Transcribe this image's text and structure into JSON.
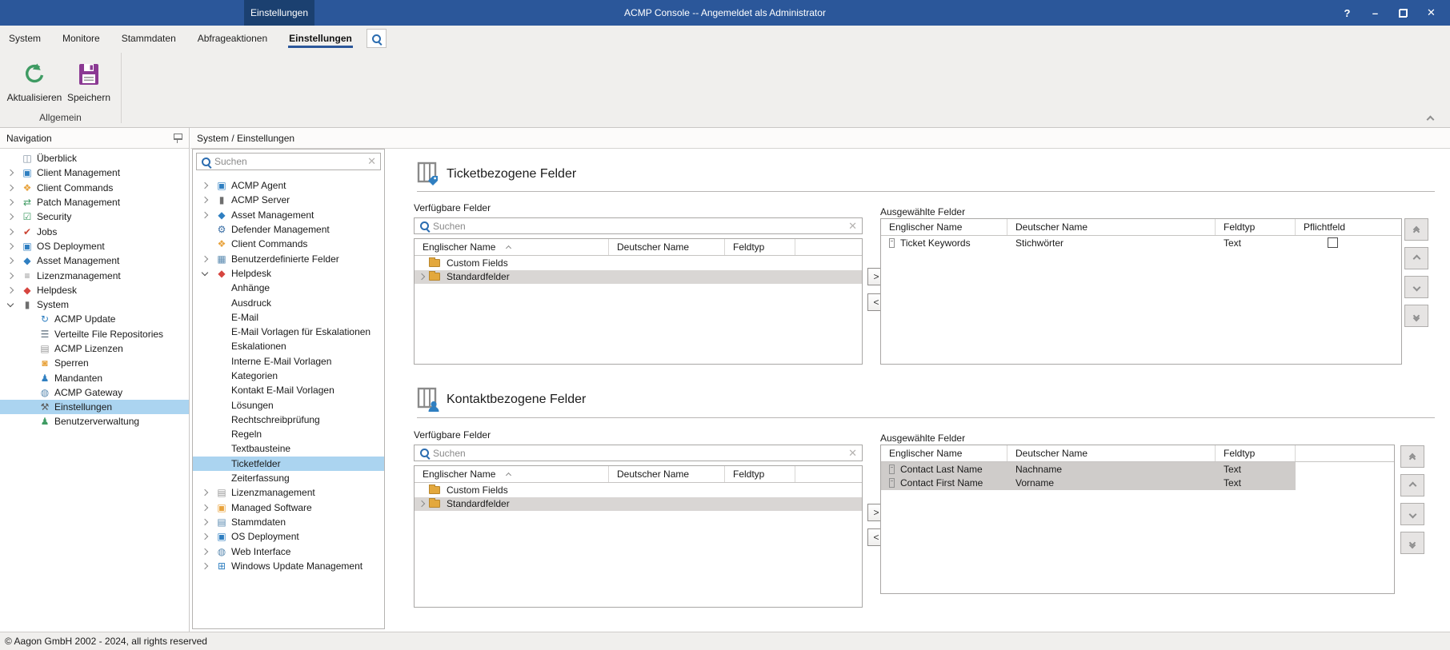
{
  "window": {
    "title": "ACMP Console -- Angemeldet als Administrator",
    "titlebar_tab": "Einstellungen",
    "controls": {
      "help": "?",
      "minimize": "–",
      "close": "✕"
    }
  },
  "menubar": {
    "items": [
      "System",
      "Monitore",
      "Stammdaten",
      "Abfrageaktionen",
      "Einstellungen"
    ],
    "active": "Einstellungen"
  },
  "ribbon": {
    "buttons": [
      {
        "label": "Aktualisieren",
        "icon": "refresh-icon"
      },
      {
        "label": "Speichern",
        "icon": "save-icon"
      }
    ],
    "group_label": "Allgemein"
  },
  "navigation": {
    "title": "Navigation",
    "items": [
      {
        "label": "Überblick",
        "icon": "overview",
        "exp": "none"
      },
      {
        "label": "Client Management",
        "icon": "client-management",
        "exp": "closed"
      },
      {
        "label": "Client Commands",
        "icon": "client-commands",
        "exp": "closed"
      },
      {
        "label": "Patch Management",
        "icon": "patch-management",
        "exp": "closed"
      },
      {
        "label": "Security",
        "icon": "security",
        "exp": "closed"
      },
      {
        "label": "Jobs",
        "icon": "jobs",
        "exp": "closed"
      },
      {
        "label": "OS Deployment",
        "icon": "os-deployment",
        "exp": "closed"
      },
      {
        "label": "Asset Management",
        "icon": "asset-management",
        "exp": "closed"
      },
      {
        "label": "Lizenzmanagement",
        "icon": "lizenzmanagement",
        "exp": "closed"
      },
      {
        "label": "Helpdesk",
        "icon": "helpdesk",
        "exp": "closed"
      },
      {
        "label": "System",
        "icon": "system",
        "exp": "open"
      },
      {
        "label": "ACMP Update",
        "icon": "acmp-update",
        "exp": "none",
        "child": true
      },
      {
        "label": "Verteilte File Repositories",
        "icon": "file-repositories",
        "exp": "none",
        "child": true
      },
      {
        "label": "ACMP Lizenzen",
        "icon": "acmp-lizenzen",
        "exp": "none",
        "child": true
      },
      {
        "label": "Sperren",
        "icon": "sperren",
        "exp": "none",
        "child": true
      },
      {
        "label": "Mandanten",
        "icon": "mandanten",
        "exp": "none",
        "child": true
      },
      {
        "label": "ACMP Gateway",
        "icon": "acmp-gateway",
        "exp": "none",
        "child": true
      },
      {
        "label": "Einstellungen",
        "icon": "einstellungen",
        "exp": "none",
        "child": true,
        "selected": true
      },
      {
        "label": "Benutzerverwaltung",
        "icon": "benutzerverwaltung",
        "exp": "none",
        "child": true
      }
    ]
  },
  "path_header": "System / Einstellungen",
  "settings_tree": {
    "search_placeholder": "Suchen",
    "items": [
      {
        "label": "ACMP Agent",
        "icon": "acmp-agent",
        "exp": "closed"
      },
      {
        "label": "ACMP Server",
        "icon": "acmp-server",
        "exp": "closed"
      },
      {
        "label": "Asset Management",
        "icon": "asset-management",
        "exp": "closed"
      },
      {
        "label": "Defender Management",
        "icon": "defender-management",
        "exp": "none"
      },
      {
        "label": "Client Commands",
        "icon": "client-commands",
        "exp": "none"
      },
      {
        "label": "Benutzerdefinierte Felder",
        "icon": "benutzerdefinierte-felder",
        "exp": "closed"
      },
      {
        "label": "Helpdesk",
        "icon": "helpdesk",
        "exp": "open"
      },
      {
        "label": "Anhänge",
        "child": true
      },
      {
        "label": "Ausdruck",
        "child": true
      },
      {
        "label": "E-Mail",
        "child": true
      },
      {
        "label": "E-Mail Vorlagen für Eskalationen",
        "child": true
      },
      {
        "label": "Eskalationen",
        "child": true
      },
      {
        "label": "Interne E-Mail Vorlagen",
        "child": true
      },
      {
        "label": "Kategorien",
        "child": true
      },
      {
        "label": "Kontakt E-Mail Vorlagen",
        "child": true
      },
      {
        "label": "Lösungen",
        "child": true
      },
      {
        "label": "Rechtschreibprüfung",
        "child": true
      },
      {
        "label": "Regeln",
        "child": true
      },
      {
        "label": "Textbausteine",
        "child": true
      },
      {
        "label": "Ticketfelder",
        "child": true,
        "selected": true
      },
      {
        "label": "Zeiterfassung",
        "child": true
      },
      {
        "label": "Lizenzmanagement",
        "icon": "acmp-lizenzen",
        "exp": "closed"
      },
      {
        "label": "Managed Software",
        "icon": "managed-software",
        "exp": "closed"
      },
      {
        "label": "Stammdaten",
        "icon": "stammdaten",
        "exp": "closed"
      },
      {
        "label": "OS Deployment",
        "icon": "os-deployment",
        "exp": "closed"
      },
      {
        "label": "Web Interface",
        "icon": "web-interface",
        "exp": "closed"
      },
      {
        "label": "Windows Update Management",
        "icon": "windows-update",
        "exp": "closed"
      }
    ]
  },
  "content": {
    "move_right_label": ">",
    "move_left_label": "<",
    "sections": [
      {
        "title": "Ticketbezogene Felder",
        "available": {
          "label": "Verfügbare Felder",
          "search_placeholder": "Suchen",
          "columns": [
            "Englischer Name",
            "Deutscher Name",
            "Feldtyp"
          ],
          "rows": [
            {
              "name": "Custom Fields",
              "expander": false,
              "selected": false
            },
            {
              "name": "Standardfelder",
              "expander": true,
              "selected": true
            }
          ]
        },
        "selected": {
          "label": "Ausgewählte Felder",
          "columns": [
            "Englischer Name",
            "Deutscher Name",
            "Feldtyp",
            "Pflichtfeld"
          ],
          "rows": [
            {
              "en": "Ticket Keywords",
              "de": "Stichwörter",
              "type": "Text",
              "required": false,
              "selected": false
            }
          ]
        }
      },
      {
        "title": "Kontaktbezogene Felder",
        "available": {
          "label": "Verfügbare Felder",
          "search_placeholder": "Suchen",
          "columns": [
            "Englischer Name",
            "Deutscher Name",
            "Feldtyp"
          ],
          "rows": [
            {
              "name": "Custom Fields",
              "expander": false,
              "selected": false
            },
            {
              "name": "Standardfelder",
              "expander": true,
              "selected": true
            }
          ]
        },
        "selected": {
          "label": "Ausgewählte Felder",
          "columns": [
            "Englischer Name",
            "Deutscher Name",
            "Feldtyp"
          ],
          "rows": [
            {
              "en": "Contact Last Name",
              "de": "Nachname",
              "type": "Text",
              "selected": true
            },
            {
              "en": "Contact First Name",
              "de": "Vorname",
              "type": "Text",
              "selected": true
            }
          ]
        }
      }
    ]
  },
  "statusbar": {
    "text": "© Aagon GmbH 2002 - 2024, all rights reserved"
  },
  "colors": {
    "titlebar": "#2b579a",
    "titlebar_tab": "#1b4070",
    "selection_blue": "#abd4f0",
    "selection_gray": "#cfccca",
    "accent_underline": "#2b579a",
    "refresh_green": "#3f9b63",
    "save_purple": "#8b3a93",
    "folder_orange": "#e3a83d"
  },
  "icons": {
    "overview": {
      "glyph": "◫",
      "color": "#7f8f9f"
    },
    "client-management": {
      "glyph": "▣",
      "color": "#2f7fc1"
    },
    "client-commands": {
      "glyph": "❖",
      "color": "#e8a33d"
    },
    "patch-management": {
      "glyph": "⇄",
      "color": "#3f9b63"
    },
    "security": {
      "glyph": "☑",
      "color": "#3f9b63"
    },
    "jobs": {
      "glyph": "✔",
      "color": "#cc4433"
    },
    "os-deployment": {
      "glyph": "▣",
      "color": "#2f7fc1"
    },
    "asset-management": {
      "glyph": "◆",
      "color": "#2f7fc1"
    },
    "lizenzmanagement": {
      "glyph": "≡",
      "color": "#8a8a8a"
    },
    "helpdesk": {
      "glyph": "◆",
      "color": "#d6453f"
    },
    "system": {
      "glyph": "▮",
      "color": "#6e6e6e"
    },
    "acmp-update": {
      "glyph": "↻",
      "color": "#2f7fc1"
    },
    "file-repositories": {
      "glyph": "☰",
      "color": "#5a6b7a"
    },
    "acmp-lizenzen": {
      "glyph": "▤",
      "color": "#9a9a9a"
    },
    "sperren": {
      "glyph": "◙",
      "color": "#e8a33d"
    },
    "mandanten": {
      "glyph": "♟",
      "color": "#2f7fc1"
    },
    "acmp-gateway": {
      "glyph": "◍",
      "color": "#5a8ab0"
    },
    "einstellungen": {
      "glyph": "⚒",
      "color": "#5a5a5a"
    },
    "benutzerverwaltung": {
      "glyph": "♟",
      "color": "#3f9b63"
    },
    "acmp-agent": {
      "glyph": "▣",
      "color": "#2f7fc1"
    },
    "acmp-server": {
      "glyph": "▮",
      "color": "#6e6e6e"
    },
    "defender-management": {
      "glyph": "⚙",
      "color": "#3a6ea5"
    },
    "benutzerdefinierte-felder": {
      "glyph": "▦",
      "color": "#5a8ab0"
    },
    "managed-software": {
      "glyph": "▣",
      "color": "#e8a33d"
    },
    "stammdaten": {
      "glyph": "▤",
      "color": "#5a8ab0"
    },
    "web-interface": {
      "glyph": "◍",
      "color": "#5a8ab0"
    },
    "windows-update": {
      "glyph": "⊞",
      "color": "#2f7fc1"
    }
  }
}
